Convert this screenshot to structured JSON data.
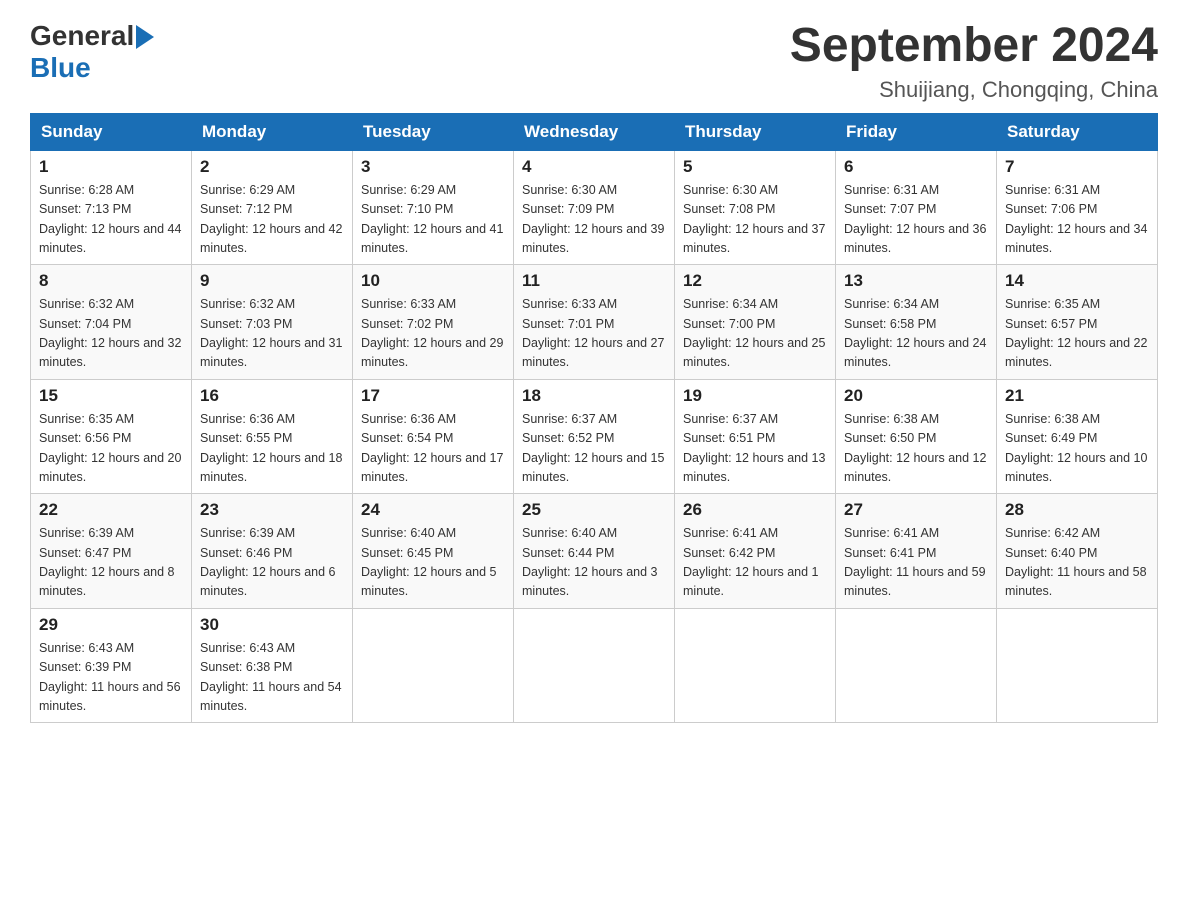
{
  "header": {
    "logo_general": "General",
    "logo_blue": "Blue",
    "title": "September 2024",
    "subtitle": "Shuijiang, Chongqing, China"
  },
  "days_of_week": [
    "Sunday",
    "Monday",
    "Tuesday",
    "Wednesday",
    "Thursday",
    "Friday",
    "Saturday"
  ],
  "weeks": [
    [
      {
        "day": "1",
        "sunrise": "6:28 AM",
        "sunset": "7:13 PM",
        "daylight": "12 hours and 44 minutes."
      },
      {
        "day": "2",
        "sunrise": "6:29 AM",
        "sunset": "7:12 PM",
        "daylight": "12 hours and 42 minutes."
      },
      {
        "day": "3",
        "sunrise": "6:29 AM",
        "sunset": "7:10 PM",
        "daylight": "12 hours and 41 minutes."
      },
      {
        "day": "4",
        "sunrise": "6:30 AM",
        "sunset": "7:09 PM",
        "daylight": "12 hours and 39 minutes."
      },
      {
        "day": "5",
        "sunrise": "6:30 AM",
        "sunset": "7:08 PM",
        "daylight": "12 hours and 37 minutes."
      },
      {
        "day": "6",
        "sunrise": "6:31 AM",
        "sunset": "7:07 PM",
        "daylight": "12 hours and 36 minutes."
      },
      {
        "day": "7",
        "sunrise": "6:31 AM",
        "sunset": "7:06 PM",
        "daylight": "12 hours and 34 minutes."
      }
    ],
    [
      {
        "day": "8",
        "sunrise": "6:32 AM",
        "sunset": "7:04 PM",
        "daylight": "12 hours and 32 minutes."
      },
      {
        "day": "9",
        "sunrise": "6:32 AM",
        "sunset": "7:03 PM",
        "daylight": "12 hours and 31 minutes."
      },
      {
        "day": "10",
        "sunrise": "6:33 AM",
        "sunset": "7:02 PM",
        "daylight": "12 hours and 29 minutes."
      },
      {
        "day": "11",
        "sunrise": "6:33 AM",
        "sunset": "7:01 PM",
        "daylight": "12 hours and 27 minutes."
      },
      {
        "day": "12",
        "sunrise": "6:34 AM",
        "sunset": "7:00 PM",
        "daylight": "12 hours and 25 minutes."
      },
      {
        "day": "13",
        "sunrise": "6:34 AM",
        "sunset": "6:58 PM",
        "daylight": "12 hours and 24 minutes."
      },
      {
        "day": "14",
        "sunrise": "6:35 AM",
        "sunset": "6:57 PM",
        "daylight": "12 hours and 22 minutes."
      }
    ],
    [
      {
        "day": "15",
        "sunrise": "6:35 AM",
        "sunset": "6:56 PM",
        "daylight": "12 hours and 20 minutes."
      },
      {
        "day": "16",
        "sunrise": "6:36 AM",
        "sunset": "6:55 PM",
        "daylight": "12 hours and 18 minutes."
      },
      {
        "day": "17",
        "sunrise": "6:36 AM",
        "sunset": "6:54 PM",
        "daylight": "12 hours and 17 minutes."
      },
      {
        "day": "18",
        "sunrise": "6:37 AM",
        "sunset": "6:52 PM",
        "daylight": "12 hours and 15 minutes."
      },
      {
        "day": "19",
        "sunrise": "6:37 AM",
        "sunset": "6:51 PM",
        "daylight": "12 hours and 13 minutes."
      },
      {
        "day": "20",
        "sunrise": "6:38 AM",
        "sunset": "6:50 PM",
        "daylight": "12 hours and 12 minutes."
      },
      {
        "day": "21",
        "sunrise": "6:38 AM",
        "sunset": "6:49 PM",
        "daylight": "12 hours and 10 minutes."
      }
    ],
    [
      {
        "day": "22",
        "sunrise": "6:39 AM",
        "sunset": "6:47 PM",
        "daylight": "12 hours and 8 minutes."
      },
      {
        "day": "23",
        "sunrise": "6:39 AM",
        "sunset": "6:46 PM",
        "daylight": "12 hours and 6 minutes."
      },
      {
        "day": "24",
        "sunrise": "6:40 AM",
        "sunset": "6:45 PM",
        "daylight": "12 hours and 5 minutes."
      },
      {
        "day": "25",
        "sunrise": "6:40 AM",
        "sunset": "6:44 PM",
        "daylight": "12 hours and 3 minutes."
      },
      {
        "day": "26",
        "sunrise": "6:41 AM",
        "sunset": "6:42 PM",
        "daylight": "12 hours and 1 minute."
      },
      {
        "day": "27",
        "sunrise": "6:41 AM",
        "sunset": "6:41 PM",
        "daylight": "11 hours and 59 minutes."
      },
      {
        "day": "28",
        "sunrise": "6:42 AM",
        "sunset": "6:40 PM",
        "daylight": "11 hours and 58 minutes."
      }
    ],
    [
      {
        "day": "29",
        "sunrise": "6:43 AM",
        "sunset": "6:39 PM",
        "daylight": "11 hours and 56 minutes."
      },
      {
        "day": "30",
        "sunrise": "6:43 AM",
        "sunset": "6:38 PM",
        "daylight": "11 hours and 54 minutes."
      },
      null,
      null,
      null,
      null,
      null
    ]
  ],
  "labels": {
    "sunrise_prefix": "Sunrise: ",
    "sunset_prefix": "Sunset: ",
    "daylight_prefix": "Daylight: "
  }
}
